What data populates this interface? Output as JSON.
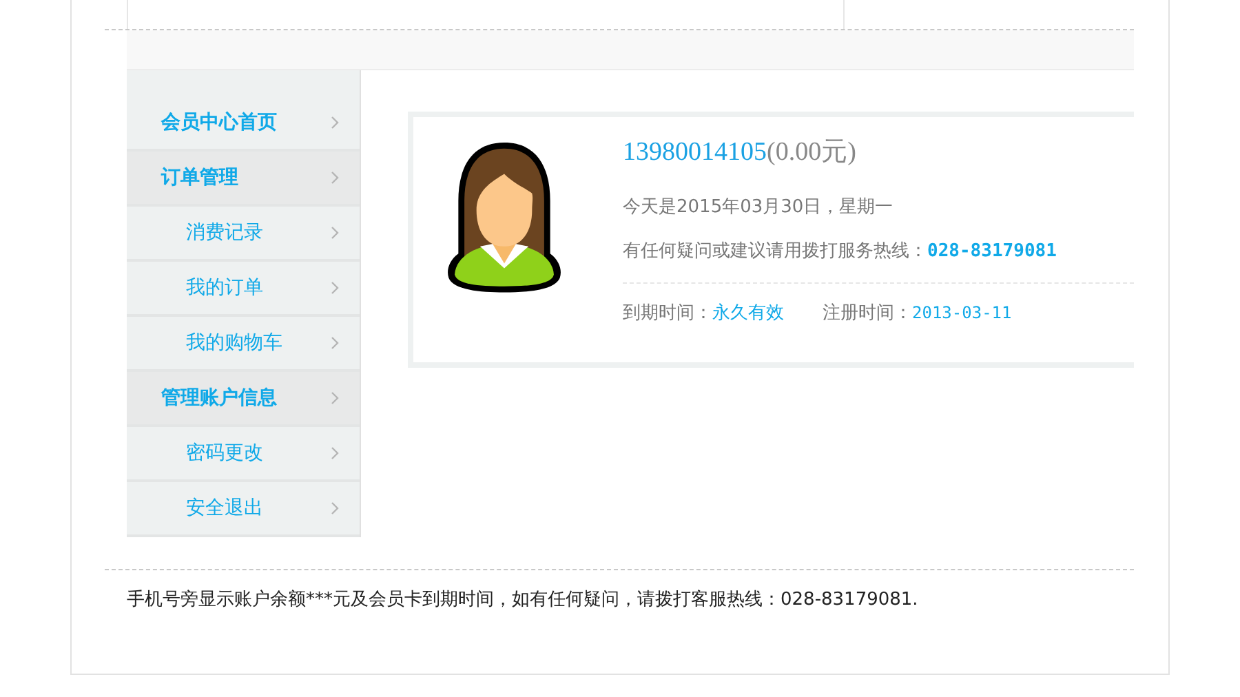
{
  "sidebar": {
    "items": [
      {
        "label": "会员中心首页",
        "kind": "home"
      },
      {
        "label": "订单管理",
        "kind": "group"
      },
      {
        "label": "消费记录",
        "kind": "sub"
      },
      {
        "label": "我的订单",
        "kind": "sub"
      },
      {
        "label": "我的购物车",
        "kind": "sub"
      },
      {
        "label": "管理账户信息",
        "kind": "group"
      },
      {
        "label": "密码更改",
        "kind": "sub"
      },
      {
        "label": "安全退出",
        "kind": "sub"
      }
    ]
  },
  "profile": {
    "phone": "13980014105",
    "balance": "(0.00元)",
    "date_line": "今天是2015年03月30日，星期一",
    "hotline_label": "有任何疑问或建议请用拨打服务热线：",
    "hotline": "028-83179081",
    "expiry_label": "到期时间：",
    "expiry": "永久有效",
    "registered_label": "注册时间：",
    "registered": "2013-03-11"
  },
  "footer_note": "手机号旁显示账户余额***元及会员卡到期时间，如有任何疑问，请拨打客服热线：028-83179081."
}
